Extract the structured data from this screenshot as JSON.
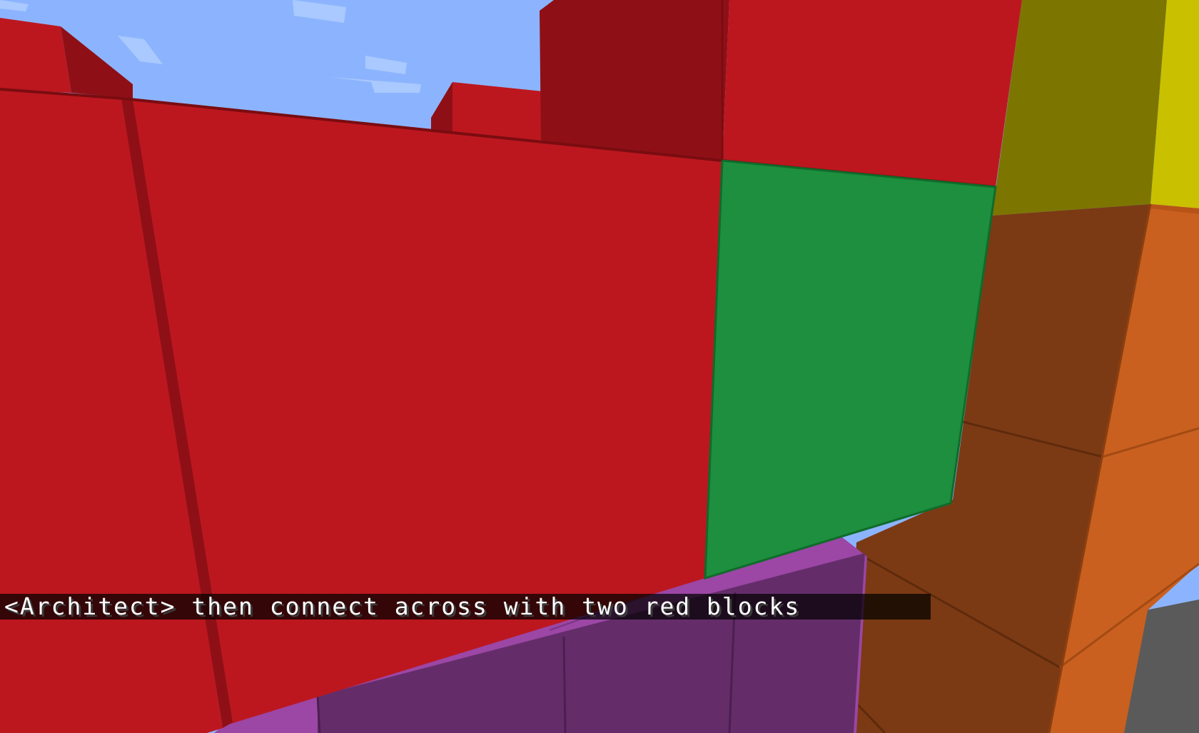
{
  "hud": {
    "chat_message": "<Architect> then connect across with two red blocks"
  },
  "scene": {
    "sky_color": "#8cb4fe",
    "cloud_color": "#a9c9ff",
    "block_colors": {
      "red_face": "#bc171f",
      "red_top": "#b6151c",
      "red_side": "#8e1016",
      "red_edge": "#7a0c10",
      "green_face": "#1d8f3e",
      "green_edge": "#0f6b2a",
      "purple_top": "#9c46a5",
      "purple_side": "#642d6a",
      "brown_face": "#7b3a14",
      "olive_face": "#7c7600",
      "yellow_face": "#c9c000",
      "orange_face": "#c9601f",
      "gray_ground": "#5a5a5a"
    }
  }
}
